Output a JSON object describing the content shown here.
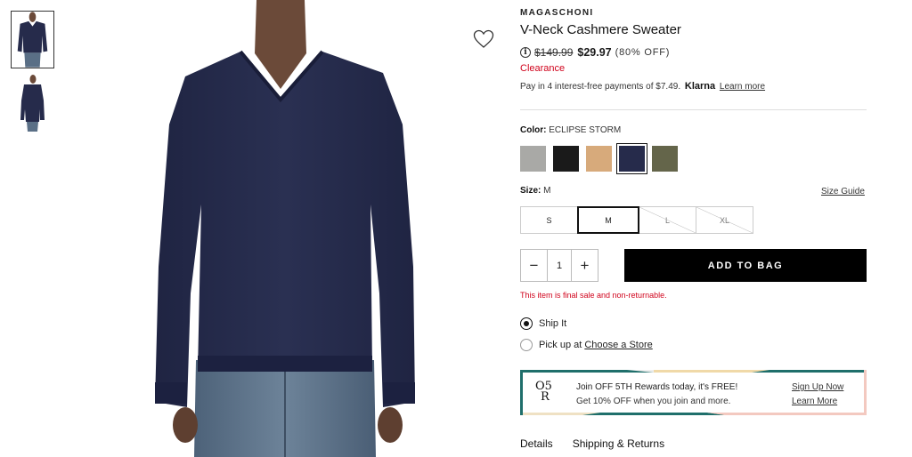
{
  "gallery": {
    "thumbnails": [
      "front-view",
      "side-view"
    ],
    "active_index": 0
  },
  "product": {
    "brand": "MAGASCHONI",
    "title": "V-Neck Cashmere Sweater",
    "original_price": "$149.99",
    "sale_price": "$29.97",
    "discount": "(80% OFF)",
    "badge": "Clearance",
    "klarna": {
      "prefix": "Pay in 4 interest-free payments of $7.49.",
      "logo": "Klarna",
      "link": "Learn more"
    }
  },
  "color": {
    "label": "Color:",
    "selected": "ECLIPSE STORM",
    "swatches": [
      {
        "name": "heather-grey",
        "hex": "#a9a9a6"
      },
      {
        "name": "black",
        "hex": "#1a1a1a"
      },
      {
        "name": "camel",
        "hex": "#d7aa7b"
      },
      {
        "name": "eclipse-storm",
        "hex": "#262b4b"
      },
      {
        "name": "olive",
        "hex": "#64654a"
      }
    ]
  },
  "size": {
    "label": "Size:",
    "selected": "M",
    "guide": "Size Guide",
    "options": [
      {
        "label": "S",
        "state": "available"
      },
      {
        "label": "M",
        "state": "selected"
      },
      {
        "label": "L",
        "state": "unavailable"
      },
      {
        "label": "XL",
        "state": "unavailable"
      }
    ]
  },
  "cart": {
    "minus": "−",
    "quantity": "1",
    "plus": "+",
    "add_to_bag": "ADD TO BAG",
    "final_sale": "This item is final sale and non-returnable."
  },
  "fulfillment": {
    "ship_label": "Ship It",
    "pickup_label": "Pick up at",
    "store_link": "Choose a Store"
  },
  "rewards": {
    "logo_top": "O5",
    "logo_bottom": "R",
    "headline": "Join OFF 5TH Rewards today, it's FREE!",
    "subtext": "Get 10% OFF when you join and more.",
    "signup": "Sign Up Now",
    "learn": "Learn More"
  },
  "tabs": [
    "Details",
    "Shipping & Returns"
  ],
  "colors": {
    "sale_red": "#d0021b",
    "sweater_navy": "#24294a",
    "button_black": "#000000"
  }
}
